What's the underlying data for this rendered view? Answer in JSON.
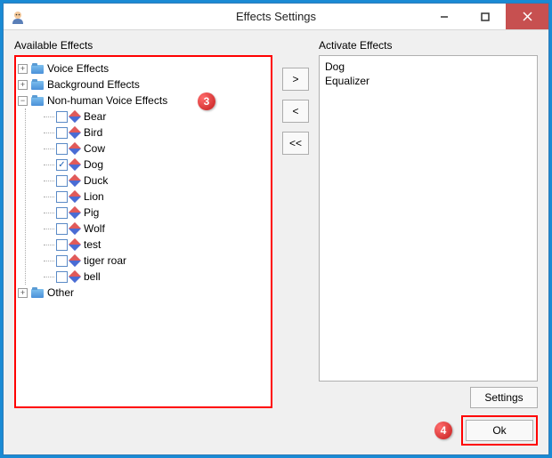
{
  "window": {
    "title": "Effects Settings"
  },
  "labels": {
    "available": "Available Effects",
    "activate": "Activate Effects"
  },
  "tree": {
    "voice_effects": "Voice Effects",
    "background_effects": "Background Effects",
    "nonhuman": "Non-human Voice Effects",
    "other": "Other",
    "items": {
      "bear": "Bear",
      "bird": "Bird",
      "cow": "Cow",
      "dog": "Dog",
      "duck": "Duck",
      "lion": "Lion",
      "pig": "Pig",
      "wolf": "Wolf",
      "test": "test",
      "tiger_roar": "tiger roar",
      "bell": "bell"
    },
    "checked": {
      "dog": true
    }
  },
  "activated": [
    "Dog",
    "Equalizer"
  ],
  "buttons": {
    "add": ">",
    "remove": "<",
    "remove_all": "<<",
    "settings": "Settings",
    "ok": "Ok"
  },
  "callouts": {
    "c3": "3",
    "c4": "4"
  }
}
